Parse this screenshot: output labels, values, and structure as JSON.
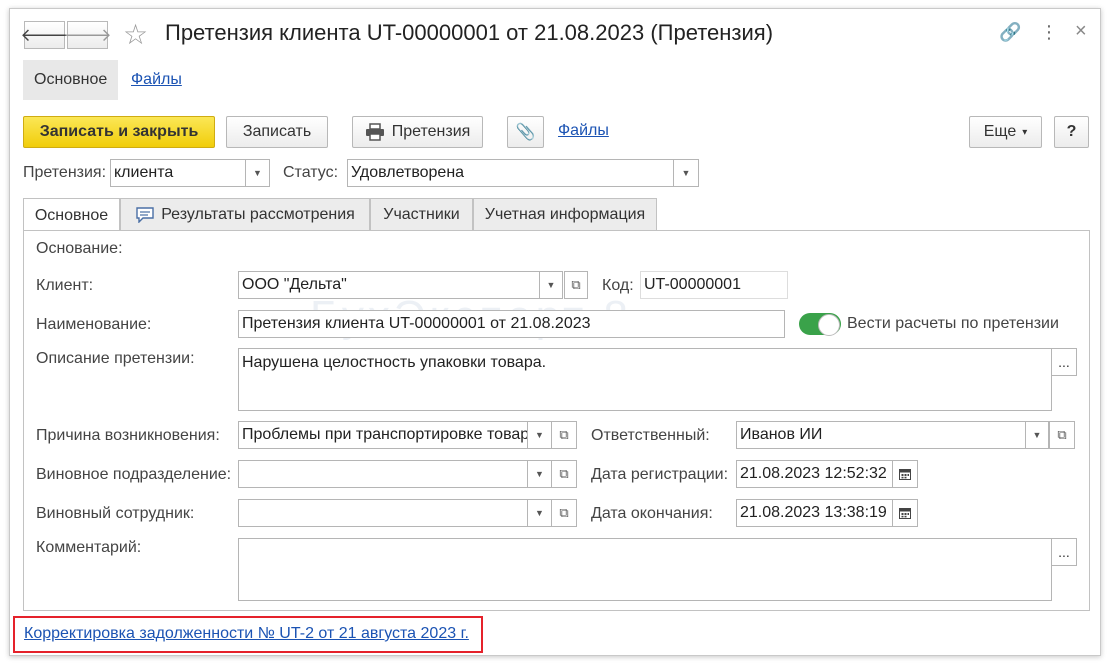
{
  "header": {
    "back_icon": "arrow-left-icon",
    "forward_icon": "arrow-right-icon",
    "back_glyph": "🡐",
    "forward_glyph": "🡒",
    "star_glyph": "☆",
    "title": "Претензия клиента UT-00000001 от 21.08.2023 (Претензия)",
    "link_glyph": "🔗",
    "menu_glyph": "⋮",
    "close_glyph": "×"
  },
  "top_tabs": [
    {
      "label": "Основное"
    },
    {
      "label": "Файлы"
    }
  ],
  "toolbar": {
    "save_close": "Записать и закрыть",
    "save": "Записать",
    "print_claim": "Претензия",
    "attach_glyph": "📎",
    "files": "Файлы",
    "more": "Еще",
    "more_arrow": "▾",
    "help": "?"
  },
  "claim_type": {
    "label": "Претензия:",
    "value": "клиента"
  },
  "status": {
    "label": "Статус:",
    "value": "Удовлетворена"
  },
  "tabs": [
    {
      "label": "Основное"
    },
    {
      "label": "Результаты рассмотрения"
    },
    {
      "label": "Участники"
    },
    {
      "label": "Учетная информация"
    }
  ],
  "form": {
    "basis_label": "Основание:",
    "client_label": "Клиент:",
    "client_value": "ООО \"Дельта\"",
    "code_label": "Код:",
    "code_value": "UT-00000001",
    "name_label": "Наименование:",
    "name_value": "Претензия клиента UT-00000001 от 21.08.2023",
    "settlements_label": "Вести расчеты по претензии",
    "settlements_on": true,
    "description_label": "Описание претензии:",
    "description_value": "Нарушена целостность упаковки товара.",
    "reason_label": "Причина возникновения:",
    "reason_value": "Проблемы при транспортировке товара",
    "responsible_label": "Ответственный:",
    "responsible_value": "Иванов ИИ",
    "guilty_dept_label": "Виновное подразделение:",
    "guilty_dept_value": "",
    "reg_date_label": "Дата регистрации:",
    "reg_date_value": "21.08.2023 12:52:32",
    "guilty_emp_label": "Виновный сотрудник:",
    "guilty_emp_value": "",
    "end_date_label": "Дата окончания:",
    "end_date_value": "21.08.2023 13:38:19",
    "comment_label": "Комментарий:",
    "comment_value": "",
    "ellipsis": "..."
  },
  "watermark": {
    "main": "БухЭксперт 8",
    "sub": "Сетов по учёту в 1С"
  },
  "bottom_link": "Корректировка задолженности № UT-2 от 21 августа 2023 г.",
  "colors": {
    "primary_button": "#f4d41e",
    "link": "#1b53b3",
    "highlight": "#e5222b",
    "toggle": "#3aa24a"
  }
}
